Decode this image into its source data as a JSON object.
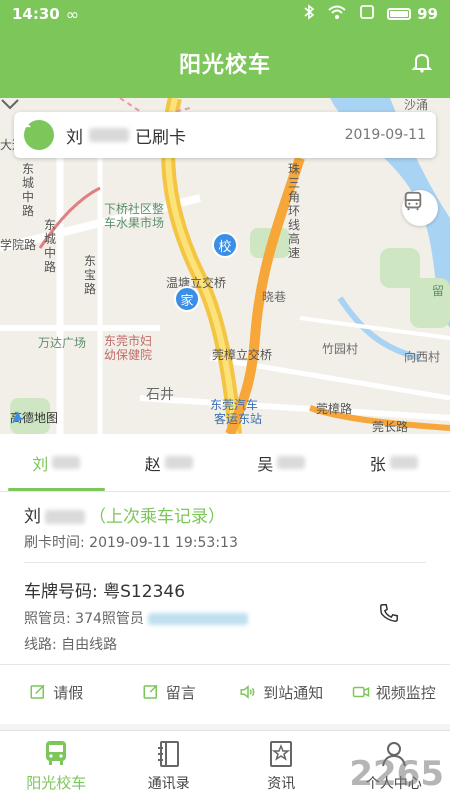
{
  "status_bar": {
    "time": "14:30",
    "infinity": "∞",
    "battery": "99"
  },
  "header": {
    "title": "阳光校车"
  },
  "notification": {
    "name_initial": "刘",
    "status": "已刷卡",
    "date": "2019-09-11"
  },
  "map": {
    "labels": {
      "l1": "东城中路",
      "l2": "学院路",
      "l3": "东城中路",
      "l4": "东宝路",
      "l5": "万达广场",
      "l6": "下桥社区整",
      "l7": "车水果市场",
      "l8": "温塘立交桥",
      "l9": "东莞市妇",
      "l10": "幼保健院",
      "l11": "莞樟立交桥",
      "l12": "竹园村",
      "l13": "石井",
      "l14": "东莞汽车",
      "l15": "客运东站",
      "l16": "莞樟路",
      "l17": "向西村",
      "l18": "晓巷",
      "l19": "沙涌",
      "l20": "留",
      "l21": "莞长路",
      "l22": "珠三角环线高速",
      "l23": "大道"
    },
    "pins": {
      "school": "校",
      "home": "家"
    },
    "attribution": "高德地图"
  },
  "tabs": [
    {
      "initial": "刘",
      "active": true
    },
    {
      "initial": "赵",
      "active": false
    },
    {
      "initial": "吴",
      "active": false
    },
    {
      "initial": "张",
      "active": false
    }
  ],
  "record": {
    "rider_initial": "刘",
    "record_link": "（上次乘车记录）",
    "swipe_label": "刷卡时间:",
    "swipe_time": "2019-09-11 19:53:13",
    "plate_label": "车牌号码:",
    "plate_value": "粤S12346",
    "guard_label": "照管员:",
    "guard_name": "374照管员",
    "route_label": "线路:",
    "route_value": "自由线路"
  },
  "actions": [
    {
      "label": "请假",
      "icon": "edit-icon"
    },
    {
      "label": "留言",
      "icon": "message-edit-icon"
    },
    {
      "label": "到站通知",
      "icon": "speaker-icon"
    },
    {
      "label": "视频监控",
      "icon": "video-icon"
    }
  ],
  "bottom_nav": [
    {
      "label": "阳光校车",
      "icon": "bus-icon",
      "active": true
    },
    {
      "label": "通讯录",
      "icon": "contacts-icon",
      "active": false
    },
    {
      "label": "资讯",
      "icon": "news-icon",
      "active": false
    },
    {
      "label": "个人中心",
      "icon": "user-icon",
      "active": false
    }
  ],
  "watermark": "2265",
  "colors": {
    "accent": "#7cc65a",
    "map_bg": "#f1efe8",
    "road_yellow": "#f4c542",
    "road_orange": "#f7a63a",
    "river": "#a9d3f2"
  }
}
